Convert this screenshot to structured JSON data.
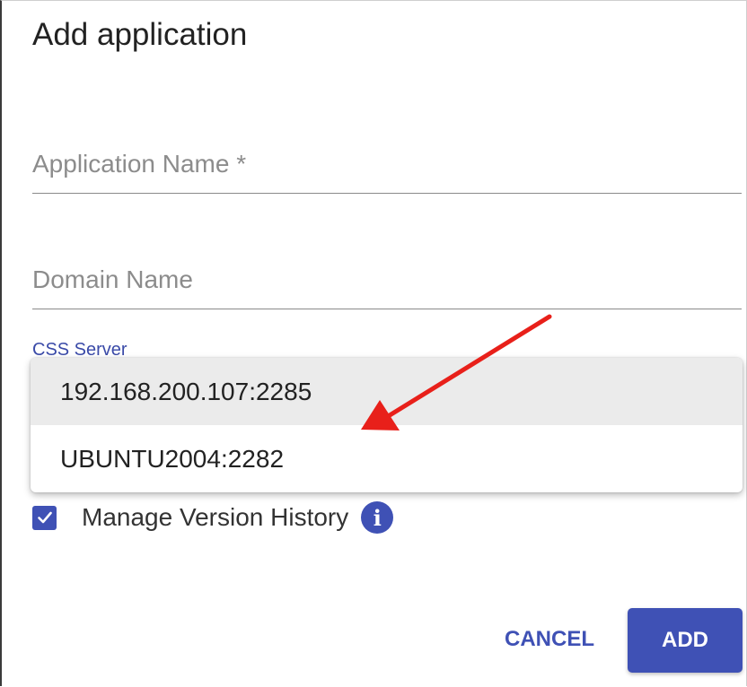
{
  "dialog": {
    "title": "Add application"
  },
  "form": {
    "application_name": {
      "value": "",
      "placeholder": "Application Name *"
    },
    "domain_name": {
      "value": "",
      "placeholder": "Domain Name"
    },
    "css_server": {
      "label": "CSS Server",
      "options": [
        "192.168.200.107:2285",
        "UBUNTU2004:2282"
      ],
      "highlighted_option": "192.168.200.107:2285"
    },
    "manage_version_history": {
      "label": "Manage Version History",
      "checked": true
    }
  },
  "actions": {
    "cancel_label": "CANCEL",
    "add_label": "ADD"
  },
  "icons": {
    "checkbox": "checkmark-icon",
    "info": "info-icon",
    "annotation": "red-arrow-icon"
  },
  "colors": {
    "accent": "#3f51b5",
    "annotation_arrow": "#e8201a",
    "highlighted_option_bg": "#ebebeb"
  }
}
